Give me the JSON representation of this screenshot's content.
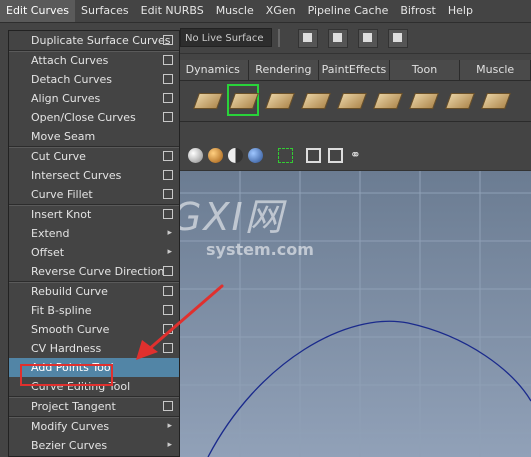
{
  "menubar": {
    "items": [
      {
        "label": "Edit Curves"
      },
      {
        "label": "Surfaces"
      },
      {
        "label": "Edit NURBS"
      },
      {
        "label": "Muscle"
      },
      {
        "label": "XGen"
      },
      {
        "label": "Pipeline Cache"
      },
      {
        "label": "Bifrost"
      },
      {
        "label": "Help"
      }
    ]
  },
  "statusline": {
    "live_surface": "No Live Surface"
  },
  "shelf": {
    "tabs": [
      {
        "label": "Dynamics"
      },
      {
        "label": "Rendering"
      },
      {
        "label": "PaintEffects"
      },
      {
        "label": "Toon"
      },
      {
        "label": "Muscle"
      }
    ]
  },
  "menu": {
    "items": [
      {
        "label": "Duplicate Surface Curves",
        "option": true,
        "submenu": false
      },
      {
        "label": "Attach Curves",
        "option": true,
        "submenu": false
      },
      {
        "label": "Detach Curves",
        "option": true,
        "submenu": false
      },
      {
        "label": "Align Curves",
        "option": true,
        "submenu": false
      },
      {
        "label": "Open/Close Curves",
        "option": true,
        "submenu": false
      },
      {
        "label": "Move Seam",
        "option": false,
        "submenu": false
      },
      {
        "label": "Cut Curve",
        "option": true,
        "submenu": false
      },
      {
        "label": "Intersect Curves",
        "option": true,
        "submenu": false
      },
      {
        "label": "Curve Fillet",
        "option": true,
        "submenu": false
      },
      {
        "label": "Insert Knot",
        "option": true,
        "submenu": false
      },
      {
        "label": "Extend",
        "option": false,
        "submenu": true
      },
      {
        "label": "Offset",
        "option": false,
        "submenu": true
      },
      {
        "label": "Reverse Curve Direction",
        "option": true,
        "submenu": false
      },
      {
        "label": "Rebuild Curve",
        "option": true,
        "submenu": false
      },
      {
        "label": "Fit B-spline",
        "option": true,
        "submenu": false
      },
      {
        "label": "Smooth Curve",
        "option": true,
        "submenu": false
      },
      {
        "label": "CV Hardness",
        "option": true,
        "submenu": false
      },
      {
        "label": "Add Points Tool",
        "option": false,
        "submenu": false
      },
      {
        "label": "Curve Editing Tool",
        "option": false,
        "submenu": false
      },
      {
        "label": "Project Tangent",
        "option": true,
        "submenu": false
      },
      {
        "label": "Modify Curves",
        "option": false,
        "submenu": true
      },
      {
        "label": "Bezier Curves",
        "option": false,
        "submenu": true
      }
    ],
    "highlighted": "Add Points Tool"
  },
  "watermark": {
    "logo": "GXI网",
    "sub": "system.com"
  },
  "colors": {
    "highlight": "#5285a6",
    "annotation_red": "#e0302e",
    "curve": "#1a2a8c",
    "selected_shelf_outline": "#29d33a"
  }
}
